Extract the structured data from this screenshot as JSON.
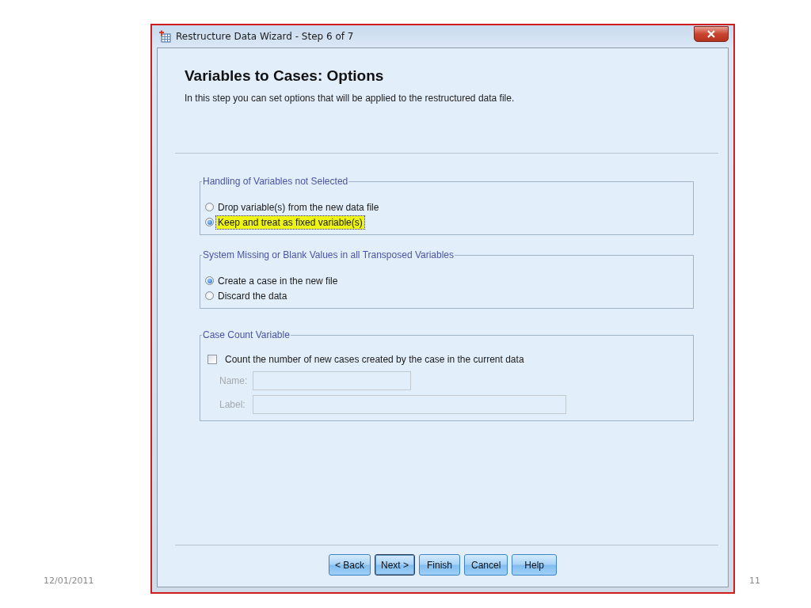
{
  "slide": {
    "date": "12/01/2011",
    "page_number": "11"
  },
  "window": {
    "title": "Restructure Data Wizard - Step 6 of 7"
  },
  "heading": "Variables to Cases: Options",
  "description": "In this step you can set options that will be applied to the restructured data file.",
  "groups": [
    {
      "title": "Handling of Variables not Selected",
      "options": [
        {
          "label": "Drop variable(s) from the new data file",
          "selected": false,
          "highlighted": false
        },
        {
          "label": "Keep and treat as fixed variable(s)",
          "selected": true,
          "highlighted": true
        }
      ]
    },
    {
      "title": "System Missing or Blank Values in all Transposed Variables",
      "options": [
        {
          "label": "Create a case in the new file",
          "selected": true,
          "highlighted": false
        },
        {
          "label": "Discard the data",
          "selected": false,
          "highlighted": false
        }
      ]
    }
  ],
  "case_count": {
    "title": "Case Count Variable",
    "checkbox": {
      "label": "Count the number of new cases created by the case in the current data",
      "checked": false
    },
    "fields": [
      {
        "label": "Name:",
        "disabled": true,
        "kind": "short"
      },
      {
        "label": "Label:",
        "disabled": true,
        "kind": "long"
      }
    ]
  },
  "buttons": [
    {
      "label": "< Back",
      "default": false
    },
    {
      "label": "Next >",
      "default": true
    },
    {
      "label": "Finish",
      "default": false
    },
    {
      "label": "Cancel",
      "default": false
    },
    {
      "label": "Help",
      "default": false
    }
  ]
}
